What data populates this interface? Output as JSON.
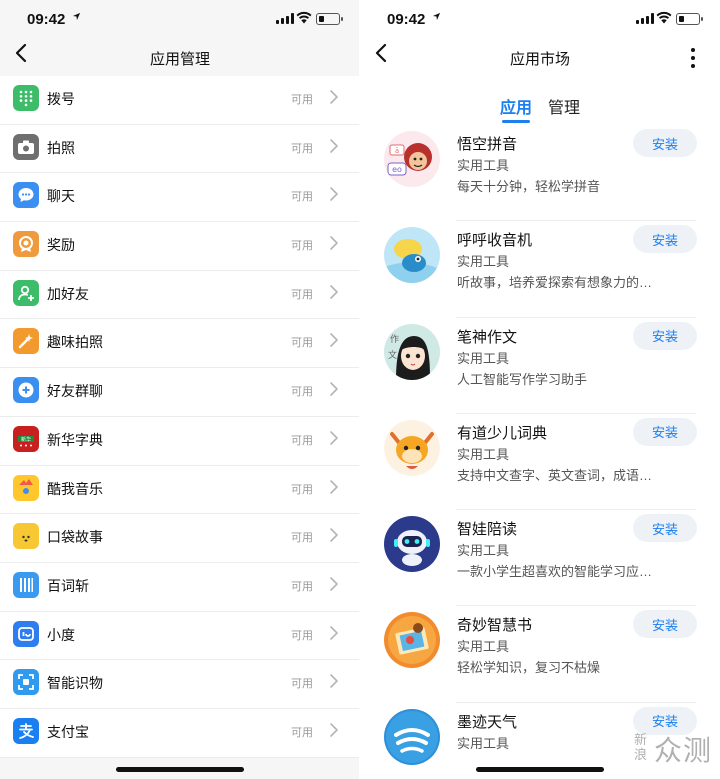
{
  "left_screen": {
    "status": {
      "time": "09:42",
      "location_icon": "location-arrow-icon"
    },
    "nav": {
      "title": "应用管理",
      "back_icon": "back-chevron-icon"
    },
    "apps": [
      {
        "label": "拨号",
        "status": "可用",
        "icon": "dialpad-icon",
        "color": "#3dbd6a"
      },
      {
        "label": "拍照",
        "status": "可用",
        "icon": "camera-icon",
        "color": "#6f6f6f"
      },
      {
        "label": "聊天",
        "status": "可用",
        "icon": "chat-bubble-icon",
        "color": "#3a8ff0"
      },
      {
        "label": "奖励",
        "status": "可用",
        "icon": "medal-icon",
        "color": "#ef9a3c"
      },
      {
        "label": "加好友",
        "status": "可用",
        "icon": "add-friend-icon",
        "color": "#3dbd6a"
      },
      {
        "label": "趣味拍照",
        "status": "可用",
        "icon": "magic-wand-icon",
        "color": "#f29a2e"
      },
      {
        "label": "好友群聊",
        "status": "可用",
        "icon": "group-chat-icon",
        "color": "#3a8ff0"
      },
      {
        "label": "新华字典",
        "status": "可用",
        "icon": "xinhua-dictionary-icon",
        "color": "#c8201e"
      },
      {
        "label": "酷我音乐",
        "status": "可用",
        "icon": "kuwo-music-icon",
        "color": "#ffc72c"
      },
      {
        "label": "口袋故事",
        "status": "可用",
        "icon": "pocket-story-fox-icon",
        "color": "#f7c734"
      },
      {
        "label": "百词斩",
        "status": "可用",
        "icon": "baicizhan-icon",
        "color": "#3a9af0"
      },
      {
        "label": "小度",
        "status": "可用",
        "icon": "xiaodu-icon",
        "color": "#2f7ef0"
      },
      {
        "label": "智能识物",
        "status": "可用",
        "icon": "object-scan-icon",
        "color": "#2f9bf0"
      },
      {
        "label": "支付宝",
        "status": "可用",
        "icon": "alipay-icon",
        "color": "#1a7ff0"
      }
    ]
  },
  "right_screen": {
    "status": {
      "time": "09:42",
      "location_icon": "location-arrow-icon"
    },
    "nav": {
      "title": "应用市场",
      "back_icon": "back-chevron-icon",
      "more_icon": "more-vertical-icon"
    },
    "tabs": [
      {
        "label": "应用",
        "active": true
      },
      {
        "label": "管理",
        "active": false
      }
    ],
    "accent": "#1b7ff0",
    "apps": [
      {
        "name": "悟空拼音",
        "category": "实用工具",
        "desc": "每天十分钟，轻松学拼音",
        "button": "安装",
        "icon": "wukong-pinyin-icon"
      },
      {
        "name": "呼呼收音机",
        "category": "实用工具",
        "desc": "听故事，培养爱探索有想象力的…",
        "button": "安装",
        "icon": "huhu-radio-icon"
      },
      {
        "name": "笔神作文",
        "category": "实用工具",
        "desc": "人工智能写作学习助手",
        "button": "安装",
        "icon": "bishen-writing-icon"
      },
      {
        "name": "有道少儿词典",
        "category": "实用工具",
        "desc": "支持中文查字、英文查词，成语…",
        "button": "安装",
        "icon": "youdao-kids-dict-icon"
      },
      {
        "name": "智娃陪读",
        "category": "实用工具",
        "desc": "一款小学生超喜欢的智能学习应…",
        "button": "安装",
        "icon": "zhiwa-robot-icon"
      },
      {
        "name": "奇妙智慧书",
        "category": "实用工具",
        "desc": "轻松学知识，复习不枯燥",
        "button": "安装",
        "icon": "wonder-book-icon"
      },
      {
        "name": "墨迹天气",
        "category": "实用工具",
        "desc": "",
        "button": "安装",
        "icon": "moji-weather-icon"
      }
    ]
  },
  "watermark": {
    "small": "新浪",
    "large": "众测"
  }
}
